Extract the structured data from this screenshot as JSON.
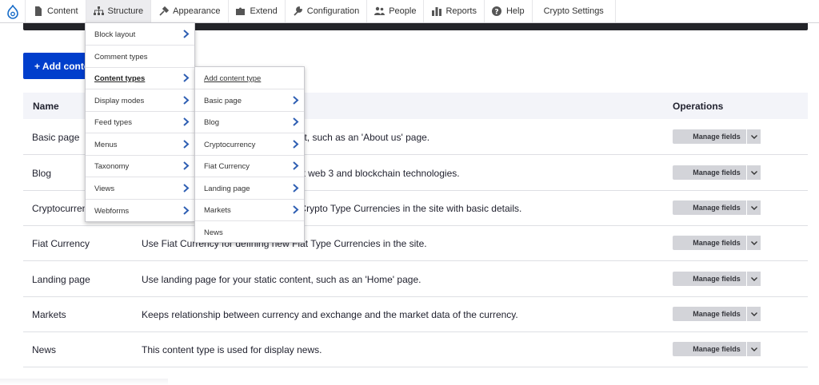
{
  "toolbar": {
    "items": [
      {
        "label": "Content",
        "icon": "file-icon"
      },
      {
        "label": "Structure",
        "icon": "structure-icon"
      },
      {
        "label": "Appearance",
        "icon": "brush-icon"
      },
      {
        "label": "Extend",
        "icon": "puzzle-icon"
      },
      {
        "label": "Configuration",
        "icon": "wrench-icon"
      },
      {
        "label": "People",
        "icon": "people-icon"
      },
      {
        "label": "Reports",
        "icon": "bar-chart-icon"
      },
      {
        "label": "Help",
        "icon": "help-icon"
      },
      {
        "label": "Crypto Settings",
        "icon": ""
      }
    ],
    "active": "Structure"
  },
  "add_button": {
    "label": "+ Add content type"
  },
  "table": {
    "headers": {
      "name": "Name",
      "operations": "Operations"
    },
    "rows": [
      {
        "name": "Basic page",
        "description": "Use basic pages for your static content, such as an 'About us' page.",
        "action": "Manage fields"
      },
      {
        "name": "Blog",
        "description": "Use Blog for sharing information about web 3 and blockchain technologies.",
        "action": "Manage fields"
      },
      {
        "name": "Cryptocurrency",
        "description": "Use Cryptocurrency for defining new Crypto Type Currencies in the site with basic details.",
        "action": "Manage fields"
      },
      {
        "name": "Fiat Currency",
        "description": "Use Fiat Currency for defining new Fiat Type Currencies in the site.",
        "action": "Manage fields"
      },
      {
        "name": "Landing page",
        "description": "Use landing page for your static content, such as an 'Home' page.",
        "action": "Manage fields"
      },
      {
        "name": "Markets",
        "description": "Keeps relationship between currency and exchange and the market data of the currency.",
        "action": "Manage fields"
      },
      {
        "name": "News",
        "description": "This content type is used for display news.",
        "action": "Manage fields"
      }
    ]
  },
  "structure_menu": {
    "items": [
      {
        "label": "Block layout",
        "has_sub": true
      },
      {
        "label": "Comment types",
        "has_sub": false
      },
      {
        "label": "Content types",
        "has_sub": true
      },
      {
        "label": "Display modes",
        "has_sub": true
      },
      {
        "label": "Feed types",
        "has_sub": true
      },
      {
        "label": "Menus",
        "has_sub": true
      },
      {
        "label": "Taxonomy",
        "has_sub": true
      },
      {
        "label": "Views",
        "has_sub": true
      },
      {
        "label": "Webforms",
        "has_sub": true
      }
    ],
    "active": "Content types"
  },
  "content_types_menu": {
    "items": [
      {
        "label": "Add content type",
        "has_sub": false
      },
      {
        "label": "Basic page",
        "has_sub": true
      },
      {
        "label": "Blog",
        "has_sub": true
      },
      {
        "label": "Cryptocurrency",
        "has_sub": true
      },
      {
        "label": "Fiat Currency",
        "has_sub": true
      },
      {
        "label": "Landing page",
        "has_sub": true
      },
      {
        "label": "Markets",
        "has_sub": true
      },
      {
        "label": "News",
        "has_sub": false
      }
    ]
  },
  "colors": {
    "accent": "#003ecc",
    "chevron": "#2f5fb3",
    "dark_bar": "#232429"
  }
}
